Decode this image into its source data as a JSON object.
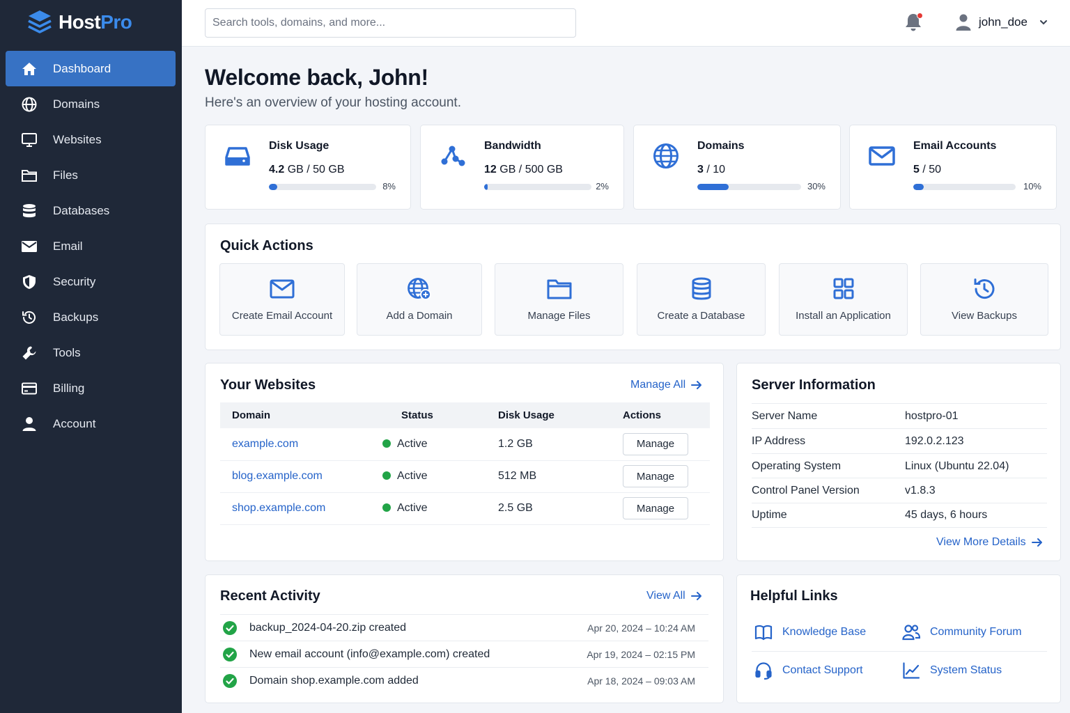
{
  "app": {
    "logo_host": "Host",
    "logo_pro": "Pro",
    "brand_color": "#3b8beb"
  },
  "sidebar": {
    "items": [
      {
        "label": "Dashboard",
        "icon": "home-icon",
        "active": true
      },
      {
        "label": "Domains",
        "icon": "globe-icon"
      },
      {
        "label": "Websites",
        "icon": "monitor-icon"
      },
      {
        "label": "Files",
        "icon": "folder-icon"
      },
      {
        "label": "Databases",
        "icon": "database-icon"
      },
      {
        "label": "Email",
        "icon": "mail-icon"
      },
      {
        "label": "Security",
        "icon": "shield-icon"
      },
      {
        "label": "Backups",
        "icon": "history-icon"
      },
      {
        "label": "Tools",
        "icon": "wrench-icon"
      },
      {
        "label": "Billing",
        "icon": "credit-card-icon"
      },
      {
        "label": "Account",
        "icon": "user-icon"
      }
    ]
  },
  "header": {
    "search_placeholder": "Search tools, domains, and more...",
    "username": "john_doe",
    "notifications": true
  },
  "welcome": {
    "title": "Welcome back, John!",
    "subtitle": "Here's an overview of your hosting account."
  },
  "stats": [
    {
      "title": "Disk Usage",
      "used": "4.2",
      "sep": " GB / ",
      "total": "50 GB",
      "percent_label": "8%",
      "percent": 8,
      "icon": "hard-drive-icon"
    },
    {
      "title": "Bandwidth",
      "used": "12",
      "sep": " GB / ",
      "total": "500 GB",
      "percent_label": "2%",
      "percent": 2,
      "icon": "network-icon"
    },
    {
      "title": "Domains",
      "used": "3",
      "sep": " / ",
      "total": "10",
      "percent_label": "30%",
      "percent": 30,
      "icon": "globe-icon"
    },
    {
      "title": "Email Accounts",
      "used": "5",
      "sep": " / ",
      "total": "50",
      "percent_label": "10%",
      "percent": 10,
      "icon": "mail-icon"
    }
  ],
  "quick_actions": {
    "title": "Quick Actions",
    "items": [
      {
        "label": "Create Email Account",
        "icon": "mail-icon"
      },
      {
        "label": "Add a Domain",
        "icon": "globe-plus-icon"
      },
      {
        "label": "Manage Files",
        "icon": "folder-icon"
      },
      {
        "label": "Create a Database",
        "icon": "database-icon"
      },
      {
        "label": "Install an Application",
        "icon": "grid-icon"
      },
      {
        "label": "View Backups",
        "icon": "history-icon"
      }
    ]
  },
  "websites": {
    "title": "Your Websites",
    "manage_all": "Manage All",
    "columns": [
      "Domain",
      "Status",
      "Disk Usage",
      "Actions"
    ],
    "rows": [
      {
        "domain": "example.com",
        "status": "Active",
        "disk": "1.2 GB",
        "action": "Manage"
      },
      {
        "domain": "blog.example.com",
        "status": "Active",
        "disk": "512 MB",
        "action": "Manage"
      },
      {
        "domain": "shop.example.com",
        "status": "Active",
        "disk": "2.5 GB",
        "action": "Manage"
      }
    ]
  },
  "server": {
    "title": "Server Information",
    "rows": [
      {
        "label": "Server Name",
        "value": "hostpro-01"
      },
      {
        "label": "IP Address",
        "value": "192.0.2.123"
      },
      {
        "label": "Operating System",
        "value": "Linux (Ubuntu 22.04)"
      },
      {
        "label": "Control Panel Version",
        "value": "v1.8.3"
      },
      {
        "label": "Uptime",
        "value": "45 days, 6 hours"
      }
    ],
    "more": "View More Details"
  },
  "activity": {
    "title": "Recent Activity",
    "view_all": "View All",
    "items": [
      {
        "text": "backup_2024-04-20.zip created",
        "time": "Apr 20, 2024 – 10:24 AM"
      },
      {
        "text": "New email account (info@example.com) created",
        "time": "Apr 19, 2024 – 02:15 PM"
      },
      {
        "text": "Domain shop.example.com added",
        "time": "Apr 18, 2024 – 09:03 AM"
      }
    ]
  },
  "helpful_links": {
    "title": "Helpful Links",
    "items": [
      {
        "label": "Knowledge Base",
        "icon": "book-icon"
      },
      {
        "label": "Community Forum",
        "icon": "users-icon"
      },
      {
        "label": "Contact Support",
        "icon": "headset-icon"
      },
      {
        "label": "System Status",
        "icon": "chart-line-icon"
      }
    ]
  }
}
